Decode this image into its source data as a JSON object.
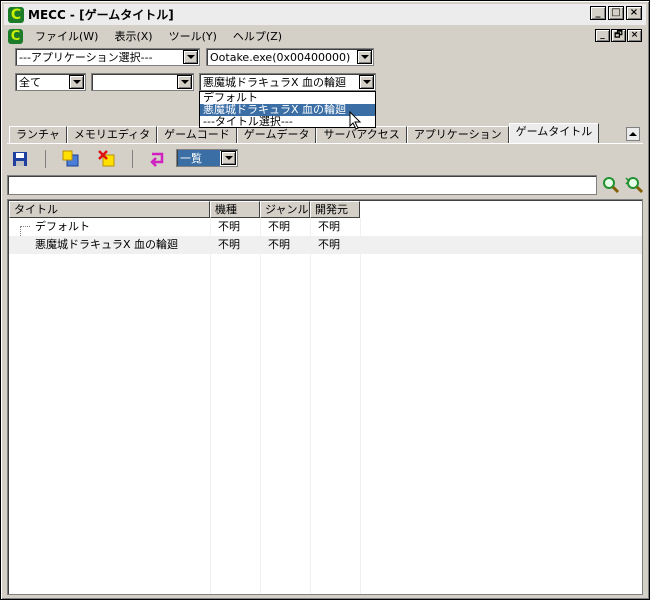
{
  "window": {
    "title": "MECC - [ゲームタイトル]",
    "app_icon": "C",
    "buttons": {
      "minimize": "_",
      "maximize": "□",
      "close": "×"
    }
  },
  "menu": {
    "items": [
      "ファイル(W)",
      "表示(X)",
      "ツール(Y)",
      "ヘルプ(Z)"
    ],
    "mdi_buttons": {
      "minimize": "_",
      "restore": "🗗",
      "close": "×"
    }
  },
  "selectors": {
    "application": "---アプリケーション選択---",
    "process": "Ootake.exe(0x00400000)",
    "filter": "全て",
    "secondary": "",
    "title": "悪魔城ドラキュラX 血の輪廻"
  },
  "dropdown": {
    "options": [
      "デフォルト",
      "悪魔城ドラキュラX 血の輪廻",
      "---タイトル選択---"
    ],
    "selected_index": 1
  },
  "tabs": [
    "ランチャ",
    "メモリエディタ",
    "ゲームコード",
    "ゲームデータ",
    "サーバアクセス",
    "アプリケーション",
    "ゲームタイトル"
  ],
  "active_tab": "ゲームタイトル",
  "toolbar": {
    "icons": [
      "save-icon",
      "new-item-icon",
      "delete-icon",
      "refresh-icon"
    ],
    "view_mode": "一覧"
  },
  "search": {
    "value": ""
  },
  "list": {
    "columns": [
      "タイトル",
      "機種",
      "ジャンル",
      "開発元"
    ],
    "rows": [
      {
        "title": "デフォルト",
        "platform": "不明",
        "genre": "不明",
        "developer": "不明"
      },
      {
        "title": "悪魔城ドラキュラX 血の輪廻",
        "platform": "不明",
        "genre": "不明",
        "developer": "不明"
      }
    ]
  },
  "colors": {
    "selection": "#3a6ea5",
    "app_icon": "#1c7c2a",
    "app_icon_text": "#c8f000"
  }
}
